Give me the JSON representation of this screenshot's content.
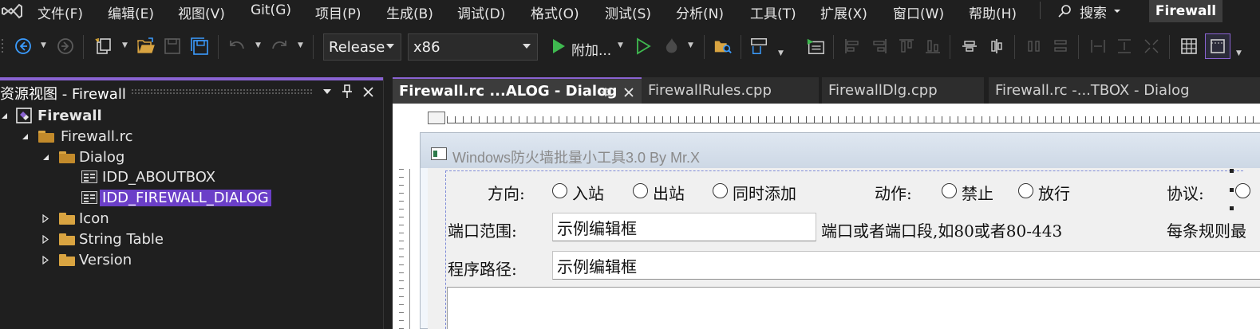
{
  "menu": {
    "items": [
      "文件(F)",
      "编辑(E)",
      "视图(V)",
      "Git(G)",
      "项目(P)",
      "生成(B)",
      "调试(D)",
      "格式(O)",
      "测试(S)",
      "分析(N)",
      "工具(T)",
      "扩展(X)",
      "窗口(W)",
      "帮助(H)"
    ],
    "search_label": "搜索",
    "solution_name": "Firewall"
  },
  "toolbar": {
    "configuration": "Release",
    "platform": "x86",
    "attach_label": "附加..."
  },
  "solution_explorer": {
    "title": "资源视图 - Firewall",
    "tree": [
      {
        "label": "Firewall",
        "level": 0,
        "expanded": true,
        "kind": "project"
      },
      {
        "label": "Firewall.rc",
        "level": 1,
        "expanded": true,
        "kind": "folder-open"
      },
      {
        "label": "Dialog",
        "level": 2,
        "expanded": true,
        "kind": "folder-open"
      },
      {
        "label": "IDD_ABOUTBOX",
        "level": 3,
        "kind": "dialog"
      },
      {
        "label": "IDD_FIREWALL_DIALOG",
        "level": 3,
        "kind": "dialog",
        "selected": true
      },
      {
        "label": "Icon",
        "level": 2,
        "expanded": false,
        "kind": "folder"
      },
      {
        "label": "String Table",
        "level": 2,
        "expanded": false,
        "kind": "folder"
      },
      {
        "label": "Version",
        "level": 2,
        "expanded": false,
        "kind": "folder"
      }
    ]
  },
  "tabs": [
    {
      "label": "Firewall.rc ...ALOG - Dialog",
      "active": true
    },
    {
      "label": "FirewallRules.cpp",
      "active": false
    },
    {
      "label": "FirewallDlg.cpp",
      "active": false
    },
    {
      "label": "Firewall.rc -...TBOX - Dialog",
      "active": false
    }
  ],
  "dialog": {
    "title": "Windows防火墙批量小工具3.0 By Mr.X",
    "direction_label": "方向:",
    "direction_options": [
      "入站",
      "出站",
      "同时添加"
    ],
    "action_label": "动作:",
    "action_options": [
      "禁止",
      "放行"
    ],
    "protocol_label": "协议:",
    "port_label": "端口范围:",
    "port_value": "示例编辑框",
    "port_hint": "端口或者端口段,如80或者80-443",
    "rule_hint": "每条规则最",
    "path_label": "程序路径:",
    "path_value": "示例编辑框"
  },
  "colors": {
    "accent": "#8a63d2",
    "selection": "#6b3fc8",
    "folder": "#d9a441",
    "nav_blue": "#3b9cff",
    "run_green": "#3fb950"
  }
}
